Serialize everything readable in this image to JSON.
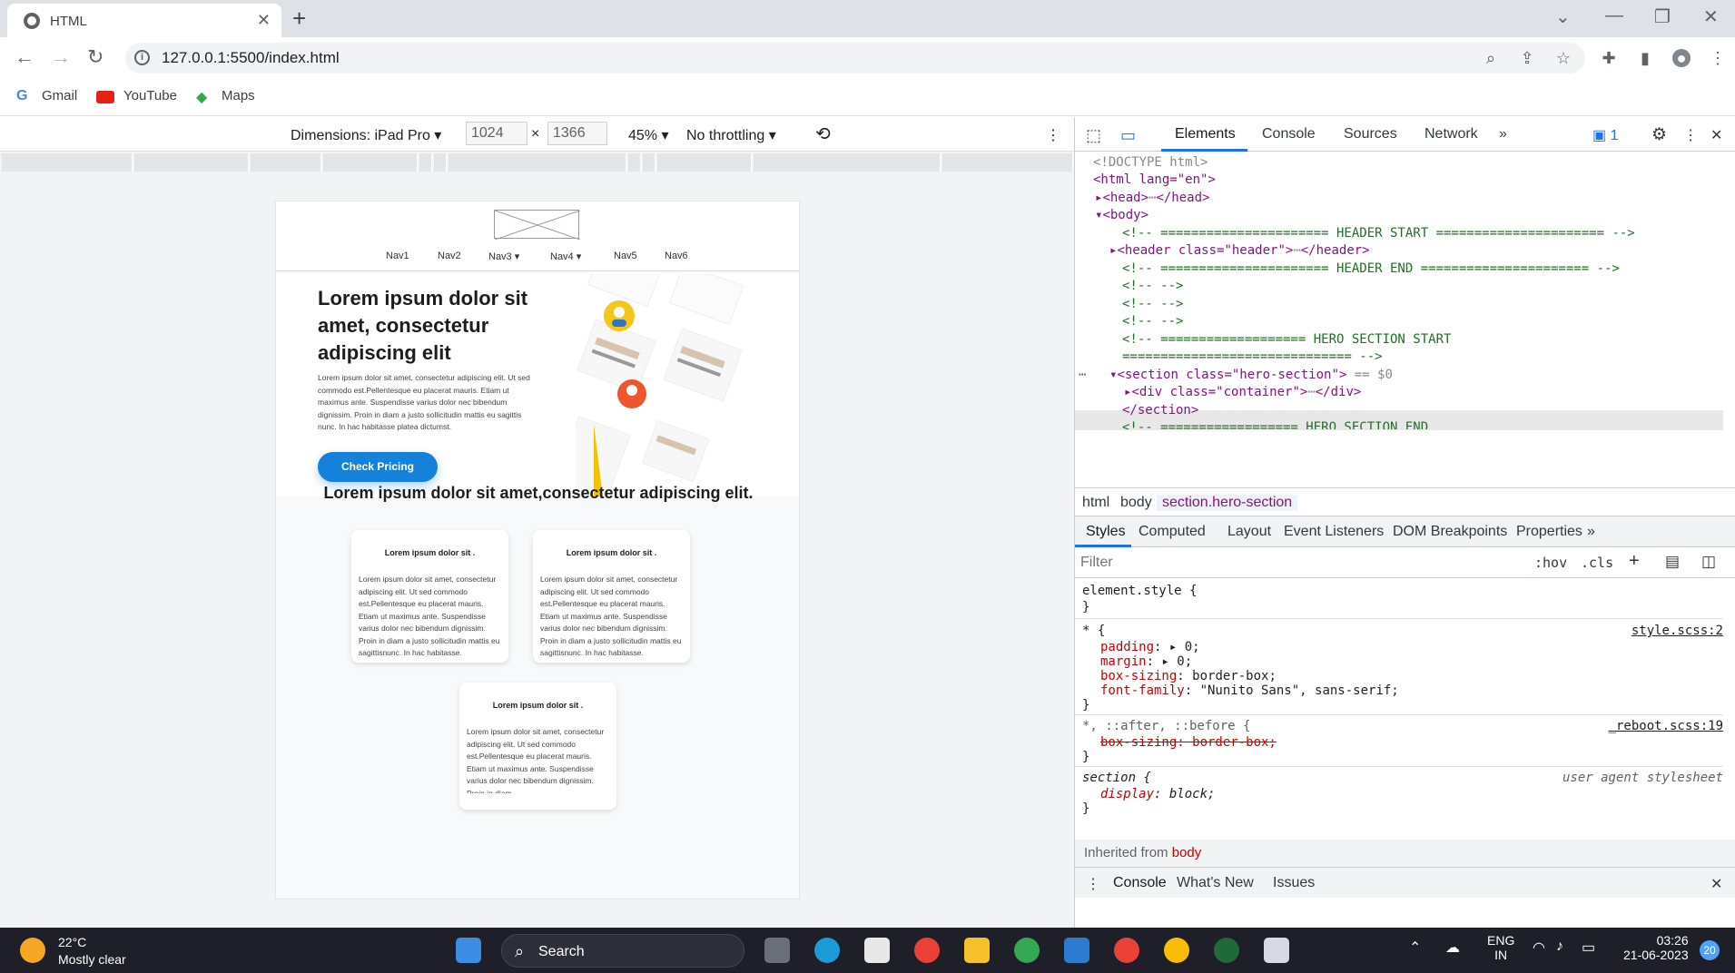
{
  "browser": {
    "tab_title": "HTML",
    "url": "127.0.0.1:5500/index.html",
    "bookmarks": [
      "Gmail",
      "YouTube",
      "Maps"
    ]
  },
  "device_toolbar": {
    "dimensions_label": "Dimensions: iPad Pro",
    "width": "1024",
    "height": "1366",
    "zoom": "45%",
    "throttling": "No throttling"
  },
  "page": {
    "nav": [
      "Nav1",
      "Nav2",
      "Nav3",
      "Nav4",
      "Nav5",
      "Nav6"
    ],
    "hero_title": "Lorem ipsum dolor sit amet, consectetur adipiscing elit",
    "hero_text": "Lorem ipsum dolor sit amet, consectetur adipiscing elit. Ut sed commodo est.Pellentesque eu placerat mauris. Etiam ut maximus ante. Suspendisse varius dolor nec bibendum dignissim. Proin in diam a justo sollicitudin mattis eu sagittis nunc. In hac habitasse platea dictumst.",
    "cta": "Check Pricing",
    "section_title": "Lorem ipsum dolor sit amet,consectetur adipiscing elit.",
    "cards": [
      {
        "title": "Lorem ipsum dolor sit .",
        "body": "Lorem ipsum dolor sit amet, consectetur adipiscing elit. Ut sed commodo est.Pellentesque eu placerat mauris. Etiam ut maximus ante. Suspendisse varius dolor nec bibendum dignissim. Proin in diam a justo sollicitudin mattis eu sagittisnunc. In hac habitasse."
      },
      {
        "title": "Lorem ipsum dolor sit .",
        "body": "Lorem ipsum dolor sit amet, consectetur adipiscing elit. Ut sed commodo est.Pellentesque eu placerat mauris. Etiam ut maximus ante. Suspendisse varius dolor nec bibendum dignissim. Proin in diam a justo sollicitudin mattis eu sagittisnunc. In hac habitasse."
      },
      {
        "title": "Lorem ipsum dolor sit .",
        "body": "Lorem ipsum dolor sit amet, consectetur adipiscing elit. Ut sed commodo est.Pellentesque eu placerat mauris. Etiam ut maximus ante. Suspendisse varius dolor nec bibendum dignissim. Proin in diam"
      }
    ]
  },
  "devtools": {
    "tabs": [
      "Elements",
      "Console",
      "Sources",
      "Network"
    ],
    "issues_count": "1",
    "dom": {
      "doctype": "<!DOCTYPE html>",
      "html_open": "<html lang=\"en\">",
      "head": "<head>",
      "head_close": "</head>",
      "body": "<body>",
      "c_header_start": "<!-- ======================  HEADER START ====================== -->",
      "header_tag": "<header class=\"header\">",
      "header_close": "</header>",
      "c_header_end": "<!-- ======================  HEADER END ====================== -->",
      "c_empty1": "<!--  -->",
      "c_empty2": "<!--  -->",
      "c_empty3": "<!--  -->",
      "c_hero_start": "<!-- =================== HERO SECTION START",
      "c_hero_start2": "============================== -->",
      "section_tag": "<section class=\"hero-section\">",
      "section_eq": "== $0",
      "container_tag": "<div class=\"container\">",
      "container_close": "</div>",
      "section_close": "</section>",
      "c_hero_end": "<!-- ================== HERO SECTION END"
    },
    "breadcrumbs": [
      "html",
      "body",
      "section.hero-section"
    ],
    "style_tabs": [
      "Styles",
      "Computed",
      "Layout",
      "Event Listeners",
      "DOM Breakpoints",
      "Properties"
    ],
    "filter_placeholder": "Filter",
    "hov": ":hov",
    "cls": ".cls",
    "styles": {
      "element_style": "element.style {",
      "star": "* {",
      "star_src": "style.scss:2",
      "padding": "padding",
      "padding_val": "0;",
      "margin": "margin",
      "margin_val": "0;",
      "box_sizing": "box-sizing",
      "box_sizing_val": "border-box;",
      "font_family": "font-family",
      "font_family_val": "\"Nunito Sans\", sans-serif;",
      "reboot_sel": "*, ::after, ::before {",
      "reboot_src": "_reboot.scss:19",
      "reboot_prop": "box-sizing: border-box;",
      "section_sel": "section {",
      "section_src": "user agent stylesheet",
      "display": "display",
      "display_val": "block;"
    },
    "inherited": "Inherited from",
    "inherited_from": "body",
    "drawer_tabs": [
      "Console",
      "What's New",
      "Issues"
    ]
  },
  "taskbar": {
    "temp": "22°C",
    "condition": "Mostly clear",
    "search": "Search",
    "lang1": "ENG",
    "lang2": "IN",
    "time": "03:26",
    "date": "21-06-2023",
    "notif": "20"
  }
}
